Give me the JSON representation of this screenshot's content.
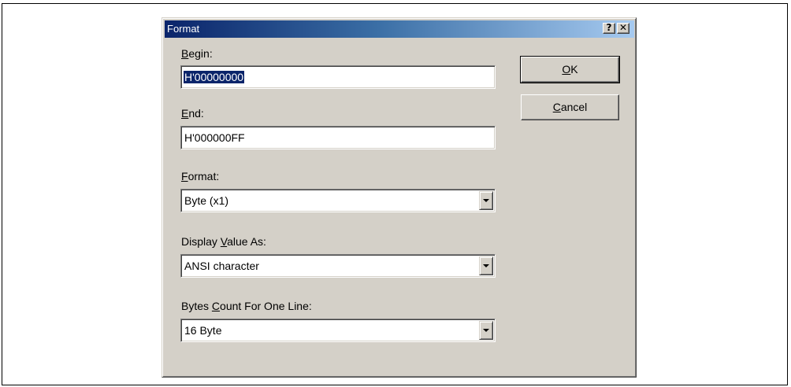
{
  "dialog": {
    "title": "Format",
    "help_button": "?",
    "close_button": "✕",
    "begin": {
      "label_mnemonic": "B",
      "label_rest": "egin:",
      "value": "H'00000000"
    },
    "end": {
      "label_mnemonic": "E",
      "label_rest": "nd:",
      "value": "H'000000FF"
    },
    "format": {
      "label_mnemonic": "F",
      "label_rest": "ormat:",
      "selected": "Byte (x1)"
    },
    "display_value_as": {
      "label_before": "Display ",
      "label_mnemonic": "V",
      "label_rest": "alue As:",
      "selected": "ANSI character"
    },
    "bytes_count": {
      "label_before": "Bytes ",
      "label_mnemonic": "C",
      "label_rest": "ount For One Line:",
      "selected": "16 Byte"
    },
    "ok_button": {
      "mnemonic": "O",
      "rest": "K"
    },
    "cancel_button": {
      "mnemonic": "C",
      "rest": "ancel"
    }
  },
  "colors": {
    "title_bar_start": "#0a246a",
    "title_bar_end": "#a6caf0",
    "dialog_face": "#d4d0c8",
    "selection": "#0a246a"
  },
  "icons": {
    "dropdown": "chevron-down-icon"
  }
}
